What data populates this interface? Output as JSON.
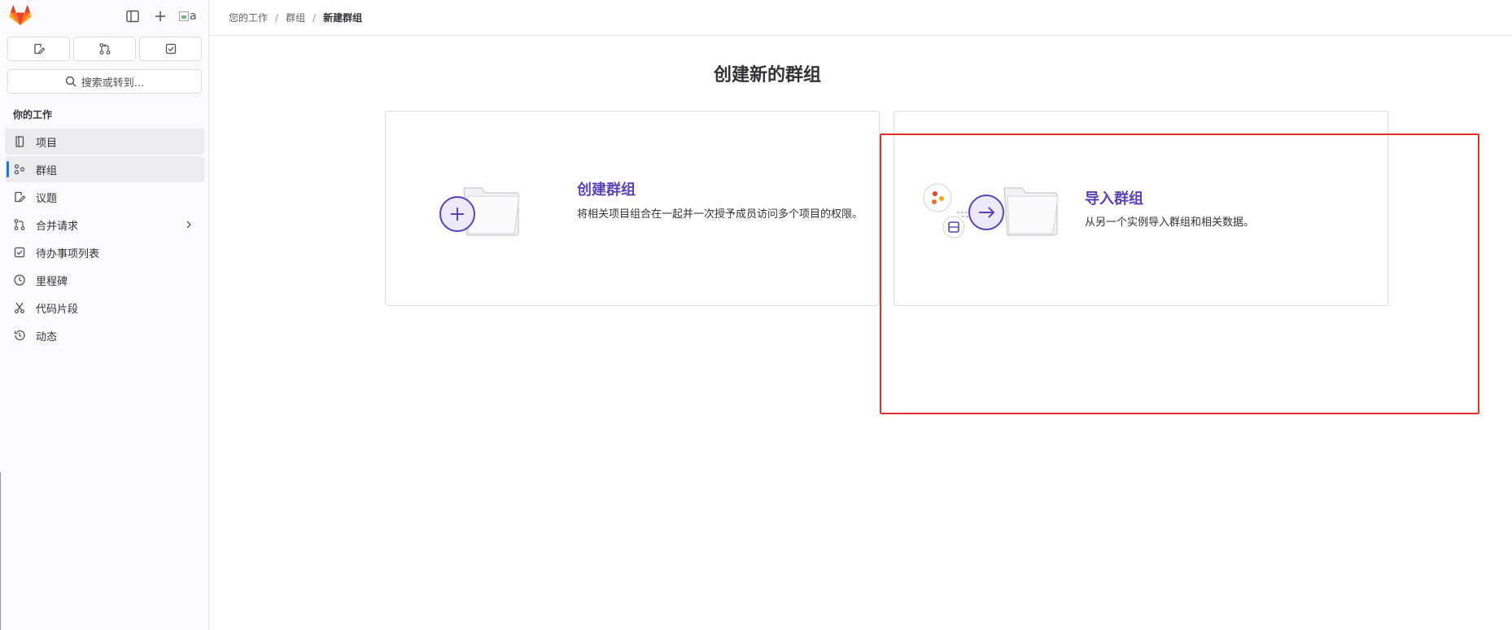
{
  "sidebar": {
    "avatar_alt": "a",
    "search_label": "搜索或转到...",
    "section_title": "你的工作",
    "items": [
      {
        "label": "项目"
      },
      {
        "label": "群组"
      },
      {
        "label": "议题"
      },
      {
        "label": "合并请求"
      },
      {
        "label": "待办事项列表"
      },
      {
        "label": "里程碑"
      },
      {
        "label": "代码片段"
      },
      {
        "label": "动态"
      }
    ]
  },
  "breadcrumb": {
    "items": [
      "您的工作",
      "群组",
      "新建群组"
    ],
    "separator": "/"
  },
  "page": {
    "title": "创建新的群组"
  },
  "cards": {
    "create": {
      "title": "创建群组",
      "description": "将相关项目组合在一起并一次授予成员访问多个项目的权限。"
    },
    "import": {
      "title": "导入群组",
      "description": "从另一个实例导入群组和相关数据。"
    }
  },
  "colors": {
    "accent": "#5943b6",
    "active_indicator": "#1f75cb",
    "highlight_box": "#e0302a",
    "gitlab_orange": "#e24329"
  }
}
